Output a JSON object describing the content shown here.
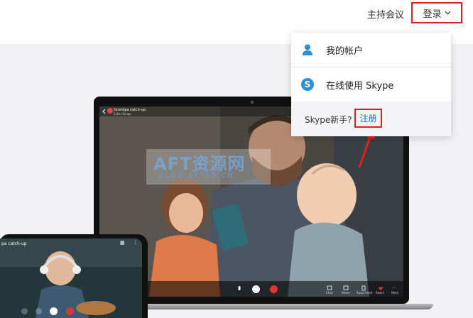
{
  "header": {
    "host_meeting": "主持会议",
    "login": "登录"
  },
  "dropdown": {
    "items": [
      {
        "label": "我的帐户",
        "icon": "person-icon"
      },
      {
        "label": "在线使用 Skype",
        "icon": "skype-icon"
      }
    ],
    "footer_text": "Skype新手?",
    "register": "注册"
  },
  "laptop_call": {
    "title": "Grandpa catch-up",
    "subtitle": "1:2n+1n-up",
    "controls": [
      "Chat",
      "Share",
      "Raise hand",
      "React",
      "More"
    ]
  },
  "phone_call": {
    "title": "pa catch-up"
  },
  "watermark": {
    "title": "AFT资源网",
    "subtitle": "BLOG.AFTSS.CN"
  },
  "colors": {
    "highlight_red": "#e02020",
    "link_blue": "#1a73c8",
    "skype_blue": "#2d8ed8",
    "end_call_red": "#e3342f"
  }
}
